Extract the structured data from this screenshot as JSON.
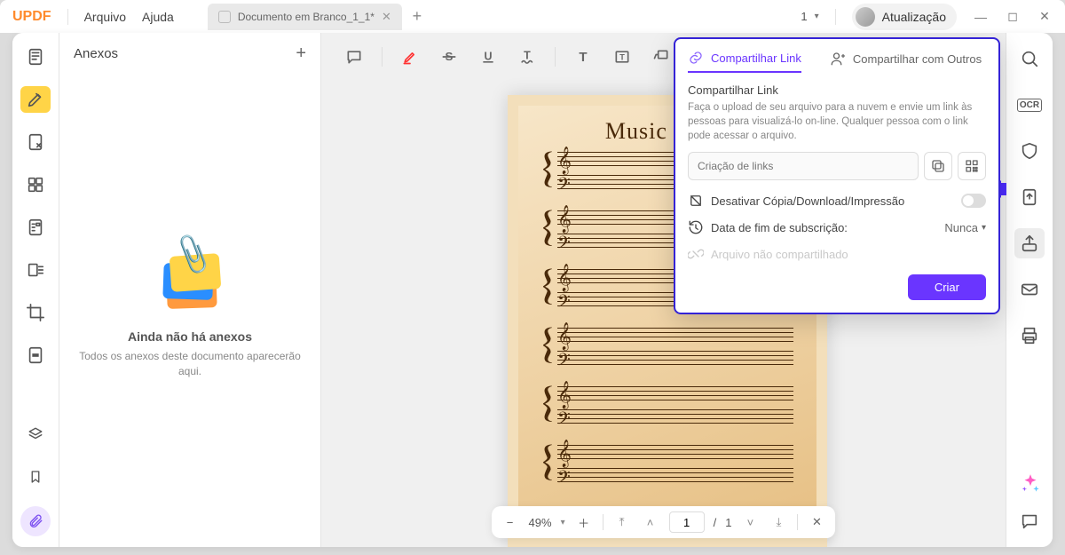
{
  "app": {
    "logo": "UPDF",
    "menu_file": "Arquivo",
    "menu_help": "Ajuda"
  },
  "tab": {
    "title": "Documento em Branco_1_1*"
  },
  "user": {
    "label": "Atualização",
    "doc_counter": "1"
  },
  "panel": {
    "title": "Anexos",
    "empty_title": "Ainda não há anexos",
    "empty_sub": "Todos os anexos deste documento aparecerão aqui."
  },
  "page": {
    "title": "Music Sheet"
  },
  "zoom": {
    "level": "49%",
    "page_current": "1",
    "page_sep": "/",
    "page_total": "1"
  },
  "share": {
    "tab_link": "Compartilhar Link",
    "tab_others": "Compartilhar com Outros",
    "title": "Compartilhar Link",
    "desc": "Faça o upload de seu arquivo para a nuvem e envie um link às pessoas para visualizá-lo on-line. Qualquer pessoa com o link pode acessar o arquivo.",
    "placeholder": "Criação de links",
    "disable_copy": "Desativar Cópia/Download/Impressão",
    "expire_label": "Data de fim de subscrição:",
    "expire_value": "Nunca",
    "not_shared": "Arquivo não compartilhado",
    "create": "Criar"
  }
}
